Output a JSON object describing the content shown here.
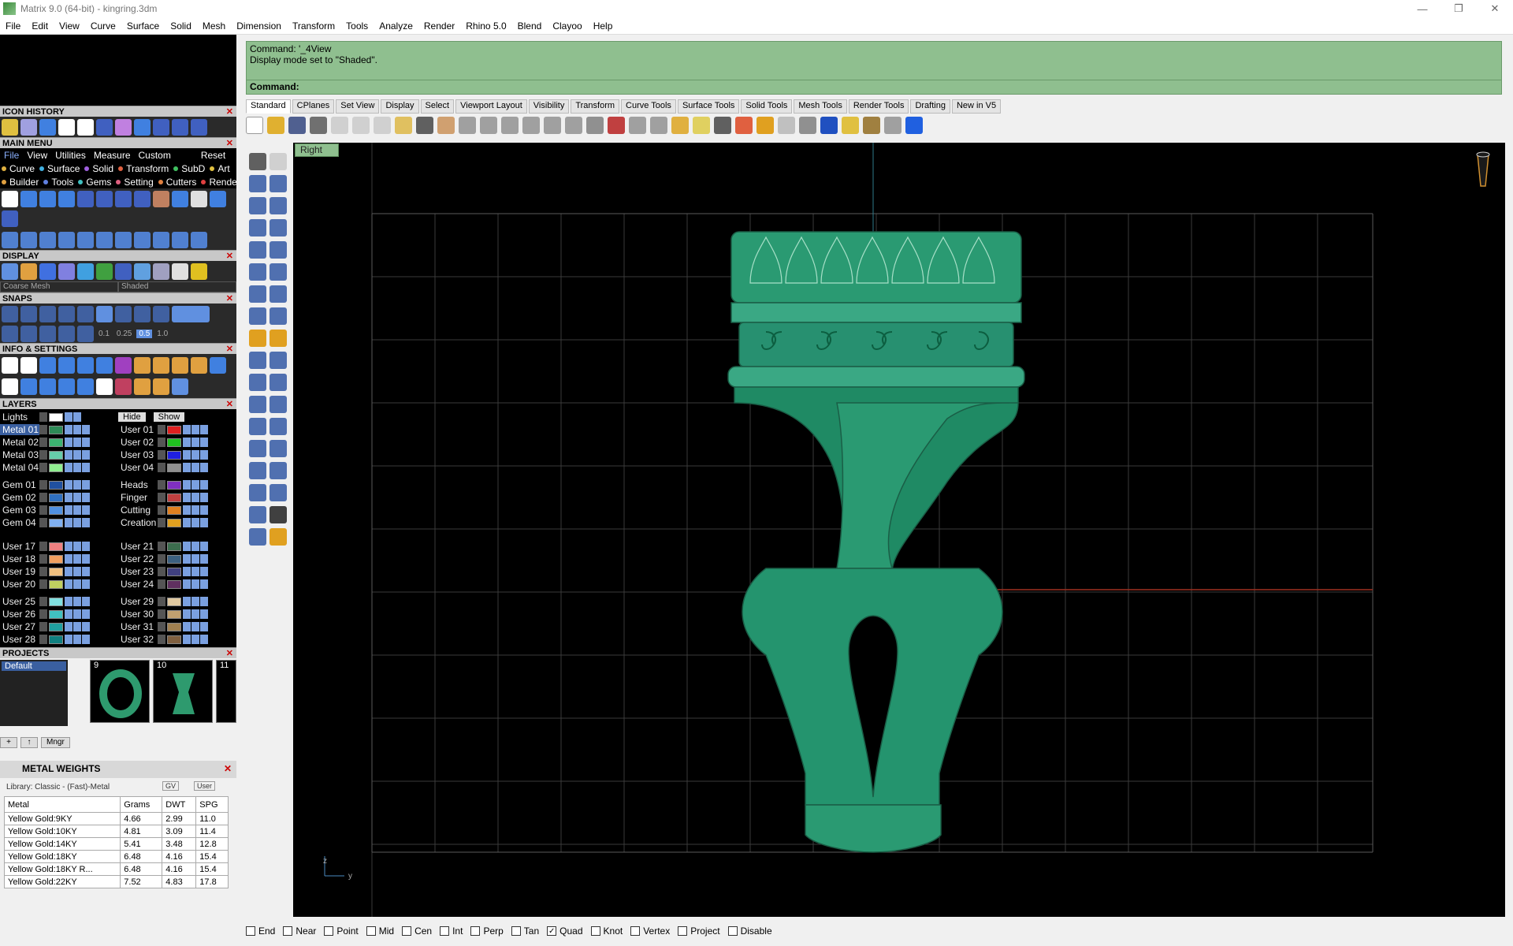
{
  "window": {
    "title": "Matrix 9.0 (64-bit) - kingring.3dm",
    "controls": [
      "—",
      "❐",
      "✕"
    ]
  },
  "menubar": [
    "File",
    "Edit",
    "View",
    "Curve",
    "Surface",
    "Solid",
    "Mesh",
    "Dimension",
    "Transform",
    "Tools",
    "Analyze",
    "Render",
    "Rhino 5.0",
    "Blend",
    "Clayoo",
    "Help"
  ],
  "panels": {
    "icon_history": "ICON HISTORY",
    "main_menu": "MAIN MENU",
    "display": "DISPLAY",
    "snaps": "SNAPS",
    "info_settings": "INFO & SETTINGS",
    "layers": "LAYERS",
    "projects": "PROJECTS",
    "metal_weights": "METAL WEIGHTS"
  },
  "main_menu": {
    "tabs": [
      "File",
      "View",
      "Utilities",
      "Measure",
      "Custom",
      "Reset"
    ],
    "row1": [
      {
        "label": "Curve",
        "color": "#e0b040"
      },
      {
        "label": "Surface",
        "color": "#40b0e0"
      },
      {
        "label": "Solid",
        "color": "#a060e0"
      },
      {
        "label": "Transform",
        "color": "#e06040"
      },
      {
        "label": "SubD",
        "color": "#40c060"
      },
      {
        "label": "Art",
        "color": "#e0c040"
      }
    ],
    "row2": [
      {
        "label": "Builder",
        "color": "#e0a040"
      },
      {
        "label": "Tools",
        "color": "#6080e0"
      },
      {
        "label": "Gems",
        "color": "#40c0c0"
      },
      {
        "label": "Setting",
        "color": "#e06080"
      },
      {
        "label": "Cutters",
        "color": "#e08040"
      },
      {
        "label": "Render",
        "color": "#e04040"
      }
    ]
  },
  "display": {
    "mesh_select": "Coarse Mesh",
    "mode_select": "Shaded"
  },
  "snaps": {
    "values": [
      "0.1",
      "0.25",
      "0.5",
      "1.0"
    ]
  },
  "layers": {
    "lights": "Lights",
    "hide_label": "Hide",
    "show_label": "Show",
    "groups": [
      [
        {
          "left": {
            "name": "Metal 01",
            "color": "#2e8b57",
            "selected": true
          },
          "right": {
            "name": "User 01",
            "color": "#e02020"
          }
        },
        {
          "left": {
            "name": "Metal 02",
            "color": "#3cb371"
          },
          "right": {
            "name": "User 02",
            "color": "#20c020"
          }
        },
        {
          "left": {
            "name": "Metal 03",
            "color": "#66cdaa"
          },
          "right": {
            "name": "User 03",
            "color": "#2020e0"
          }
        },
        {
          "left": {
            "name": "Metal 04",
            "color": "#90ee90"
          },
          "right": {
            "name": "User 04",
            "color": "#909090"
          }
        }
      ],
      [
        {
          "left": {
            "name": "Gem 01",
            "color": "#2050a0"
          },
          "right": {
            "name": "Heads",
            "color": "#8030c0"
          }
        },
        {
          "left": {
            "name": "Gem 02",
            "color": "#3070c0"
          },
          "right": {
            "name": "Finger",
            "color": "#c04040"
          }
        },
        {
          "left": {
            "name": "Gem 03",
            "color": "#5090e0"
          },
          "right": {
            "name": "Cutting",
            "color": "#e08020"
          }
        },
        {
          "left": {
            "name": "Gem 04",
            "color": "#80b0f0"
          },
          "right": {
            "name": "Creation",
            "color": "#e0a020"
          }
        }
      ],
      [
        {
          "left": {
            "name": "User 17",
            "color": "#f08080"
          },
          "right": {
            "name": "User 21",
            "color": "#3c6e4e"
          }
        },
        {
          "left": {
            "name": "User 18",
            "color": "#f0a060"
          },
          "right": {
            "name": "User 22",
            "color": "#3c6080"
          }
        },
        {
          "left": {
            "name": "User 19",
            "color": "#f0c080"
          },
          "right": {
            "name": "User 23",
            "color": "#404080"
          }
        },
        {
          "left": {
            "name": "User 20",
            "color": "#c0d060"
          },
          "right": {
            "name": "User 24",
            "color": "#603060"
          }
        }
      ],
      [
        {
          "left": {
            "name": "User 25",
            "color": "#80e0e0"
          },
          "right": {
            "name": "User 29",
            "color": "#e0c8a0"
          }
        },
        {
          "left": {
            "name": "User 26",
            "color": "#40c0c0"
          },
          "right": {
            "name": "User 30",
            "color": "#c0a070"
          }
        },
        {
          "left": {
            "name": "User 27",
            "color": "#20a0a0"
          },
          "right": {
            "name": "User 31",
            "color": "#a08050"
          }
        },
        {
          "left": {
            "name": "User 28",
            "color": "#108080"
          },
          "right": {
            "name": "User 32",
            "color": "#806040"
          }
        }
      ]
    ]
  },
  "projects": {
    "default": "Default",
    "thumbs": [
      "9",
      "10",
      "11"
    ],
    "manager_button": "Mngr"
  },
  "metal_weights": {
    "library": "Library: Classic - (Fast)-Metal",
    "gv": "GV",
    "user": "User",
    "columns": [
      "Metal",
      "Grams",
      "DWT",
      "SPG"
    ],
    "rows": [
      [
        "Yellow Gold:9KY",
        "4.66",
        "2.99",
        "11.0"
      ],
      [
        "Yellow Gold:10KY",
        "4.81",
        "3.09",
        "11.4"
      ],
      [
        "Yellow Gold:14KY",
        "5.41",
        "3.48",
        "12.8"
      ],
      [
        "Yellow Gold:18KY",
        "6.48",
        "4.16",
        "15.4"
      ],
      [
        "Yellow Gold:18KY R...",
        "6.48",
        "4.16",
        "15.4"
      ],
      [
        "Yellow Gold:22KY",
        "7.52",
        "4.83",
        "17.8"
      ]
    ]
  },
  "command": {
    "history_line1": "Command: '_4View",
    "history_line2": "Display mode set to \"Shaded\".",
    "prompt": "Command:"
  },
  "toolbar_tabs": [
    "Standard",
    "CPlanes",
    "Set View",
    "Display",
    "Select",
    "Viewport Layout",
    "Visibility",
    "Transform",
    "Curve Tools",
    "Surface Tools",
    "Solid Tools",
    "Mesh Tools",
    "Render Tools",
    "Drafting",
    "New in V5"
  ],
  "viewport": {
    "label": "Right",
    "axis_z": "z",
    "axis_y": "y"
  },
  "osnaps": [
    {
      "label": "End",
      "checked": false
    },
    {
      "label": "Near",
      "checked": false
    },
    {
      "label": "Point",
      "checked": false
    },
    {
      "label": "Mid",
      "checked": false
    },
    {
      "label": "Cen",
      "checked": false
    },
    {
      "label": "Int",
      "checked": false
    },
    {
      "label": "Perp",
      "checked": false
    },
    {
      "label": "Tan",
      "checked": false
    },
    {
      "label": "Quad",
      "checked": true
    },
    {
      "label": "Knot",
      "checked": false
    },
    {
      "label": "Vertex",
      "checked": false
    },
    {
      "label": "Project",
      "checked": false
    },
    {
      "label": "Disable",
      "checked": false
    }
  ]
}
